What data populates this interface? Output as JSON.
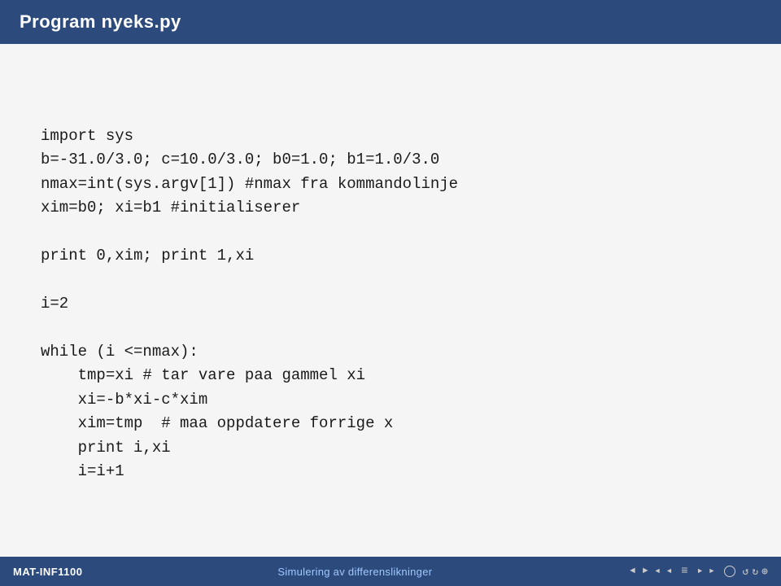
{
  "titleBar": {
    "title": "Program nyeks.py"
  },
  "code": {
    "lines": [
      "import sys",
      "b=-31.0/3.0; c=10.0/3.0; b0=1.0; b1=1.0/3.0",
      "nmax=int(sys.argv[1]) #nmax fra kommandolinje",
      "xim=b0; xi=b1 #initialiserer",
      "",
      "print 0,xim; print 1,xi",
      "",
      "i=2",
      "",
      "while (i <=nmax):",
      "    tmp=xi # tar vare paa gammel xi",
      "    xi=-b*xi-c*xim",
      "    xim=tmp  # maa oppdatere forrige x",
      "    print i,xi",
      "    i=i+1"
    ]
  },
  "bottomBar": {
    "leftLabel": "MAT-INF1100",
    "centerLabel": "Simulering av differenslikninger",
    "navControls": {
      "prevLabel": "◄",
      "nextLabel": "►",
      "circleLabel": "○",
      "menuLabel": "≡",
      "refreshLabel": "↺"
    }
  }
}
